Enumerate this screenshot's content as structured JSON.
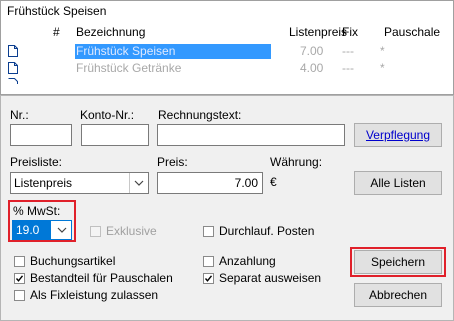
{
  "list": {
    "title": "Frühstück Speisen",
    "headers": [
      "#",
      "Bezeichnung",
      "Listenpreis",
      "Fix",
      "Pauschale"
    ],
    "rows": [
      {
        "name": "Frühstück Speisen",
        "price": "7.00",
        "fix": "---",
        "pauschale": "*"
      },
      {
        "name": "Frühstück Getränke",
        "price": "4.00",
        "fix": "---",
        "pauschale": "*"
      }
    ]
  },
  "form": {
    "nr_label": "Nr.:",
    "konto_label": "Konto-Nr.:",
    "rechnungstext_label": "Rechnungstext:",
    "verpflegung_label": "Verpflegung",
    "preisliste_label": "Preisliste:",
    "preisliste_value": "Listenpreis",
    "preis_label": "Preis:",
    "preis_value": "7.00",
    "waehrung_label": "Währung:",
    "currency": "€",
    "alle_listen_label": "Alle Listen",
    "mwst_label": "% MwSt:",
    "mwst_value": "19.0",
    "exklusive_label": "Exklusive",
    "durchlauf_label": "Durchlauf. Posten",
    "buchungsartikel_label": "Buchungsartikel",
    "anzahlung_label": "Anzahlung",
    "bestandteil_label": "Bestandteil für Pauschalen",
    "separat_label": "Separat ausweisen",
    "fixleistung_label": "Als Fixleistung zulassen",
    "speichern_label": "Speichern",
    "abbrechen_label": "Abbrechen"
  },
  "colors": {
    "highlight": "#e0202a",
    "selection": "#3399ff"
  }
}
